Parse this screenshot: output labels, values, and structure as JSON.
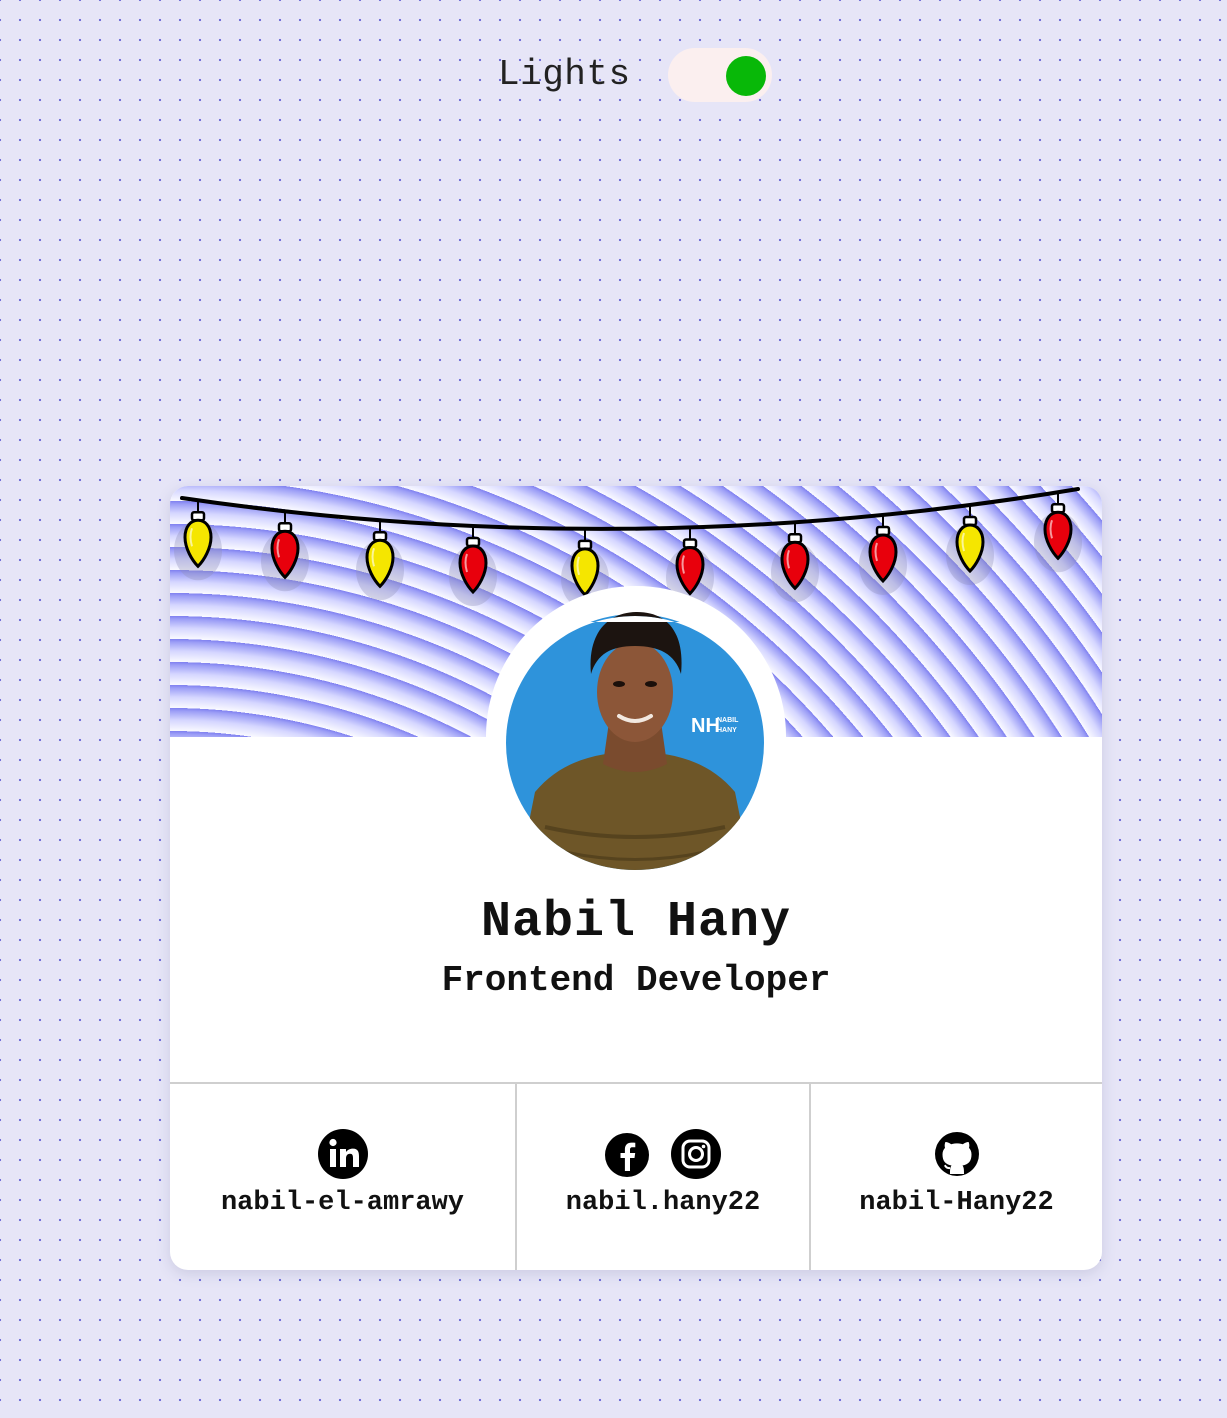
{
  "toggle": {
    "label": "Lights",
    "on": true,
    "knob_color": "#08b808"
  },
  "profile": {
    "name": "Nabil Hany",
    "role": "Frontend Developer",
    "avatar_badge_line1": "NABIL",
    "avatar_badge_line2": "HANY"
  },
  "lights": {
    "bulb_colors": [
      "#f5e600",
      "#e8000c",
      "#f5e600",
      "#e8000c",
      "#f5e600",
      "#e8000c",
      "#e8000c",
      "#e8000c",
      "#f5e600",
      "#e8000c"
    ]
  },
  "socials": [
    {
      "icons": [
        "linkedin-icon"
      ],
      "handle": "nabil-el-amrawy"
    },
    {
      "icons": [
        "facebook-icon",
        "instagram-icon"
      ],
      "handle": "nabil.hany22"
    },
    {
      "icons": [
        "github-icon"
      ],
      "handle": "nabil-Hany22"
    }
  ]
}
